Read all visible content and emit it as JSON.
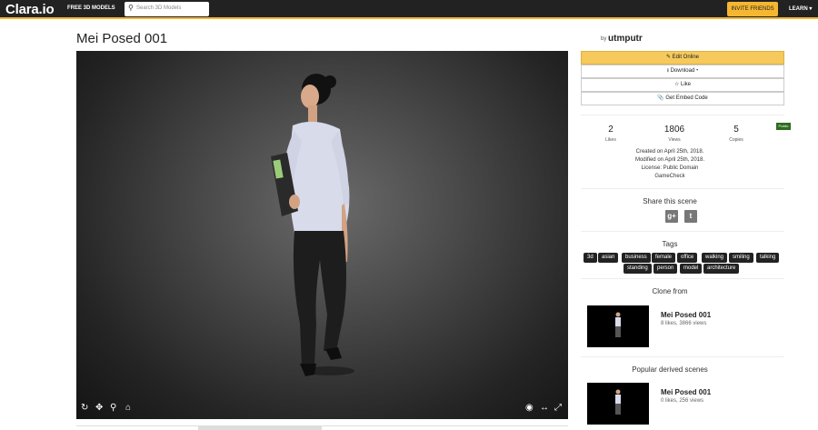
{
  "header": {
    "logo": "Clara.io",
    "nav_free_models": "FREE 3D MODELS",
    "search_placeholder": "Search 3D Models",
    "invite_label": "INVITE FRIENDS",
    "learn_label": "LEARN ▾"
  },
  "scene": {
    "title": "Mei Posed 001",
    "by_label": "by",
    "author": "utmputr"
  },
  "actions": {
    "edit_online": "✎ Edit Online",
    "download": "⭳ Download ▾",
    "like": "☆ Like",
    "embed": "📎 Get Embed Code"
  },
  "stats": {
    "likes_value": "2",
    "likes_label": "Likes",
    "views_value": "1806",
    "views_label": "Views",
    "copies_value": "5",
    "copies_label": "Copies",
    "public_badge": "Public"
  },
  "meta": {
    "created": "Created on April 25th, 2018.",
    "modified": "Modified on April 25th, 2018.",
    "license": "License: Public Domain",
    "gamecheck": "GameCheck"
  },
  "share": {
    "title": "Share this scene",
    "gplus": "g+",
    "twitter": "t"
  },
  "tags": {
    "title": "Tags",
    "items": [
      "3d",
      "asian",
      "business",
      "female",
      "office",
      "walking",
      "smiling",
      "talking",
      "standing",
      "person",
      "model",
      "architecture"
    ]
  },
  "clone_from": {
    "title": "Clone from",
    "name": "Mei Posed 001",
    "sub": "8 likes, 3866 views"
  },
  "derived": {
    "title": "Popular derived scenes",
    "name": "Mei Posed 001",
    "sub": "0 likes, 256 views"
  },
  "colors": {
    "accent": "#f5b731",
    "header_bg": "#222222",
    "public_badge": "#2e6b1f"
  }
}
